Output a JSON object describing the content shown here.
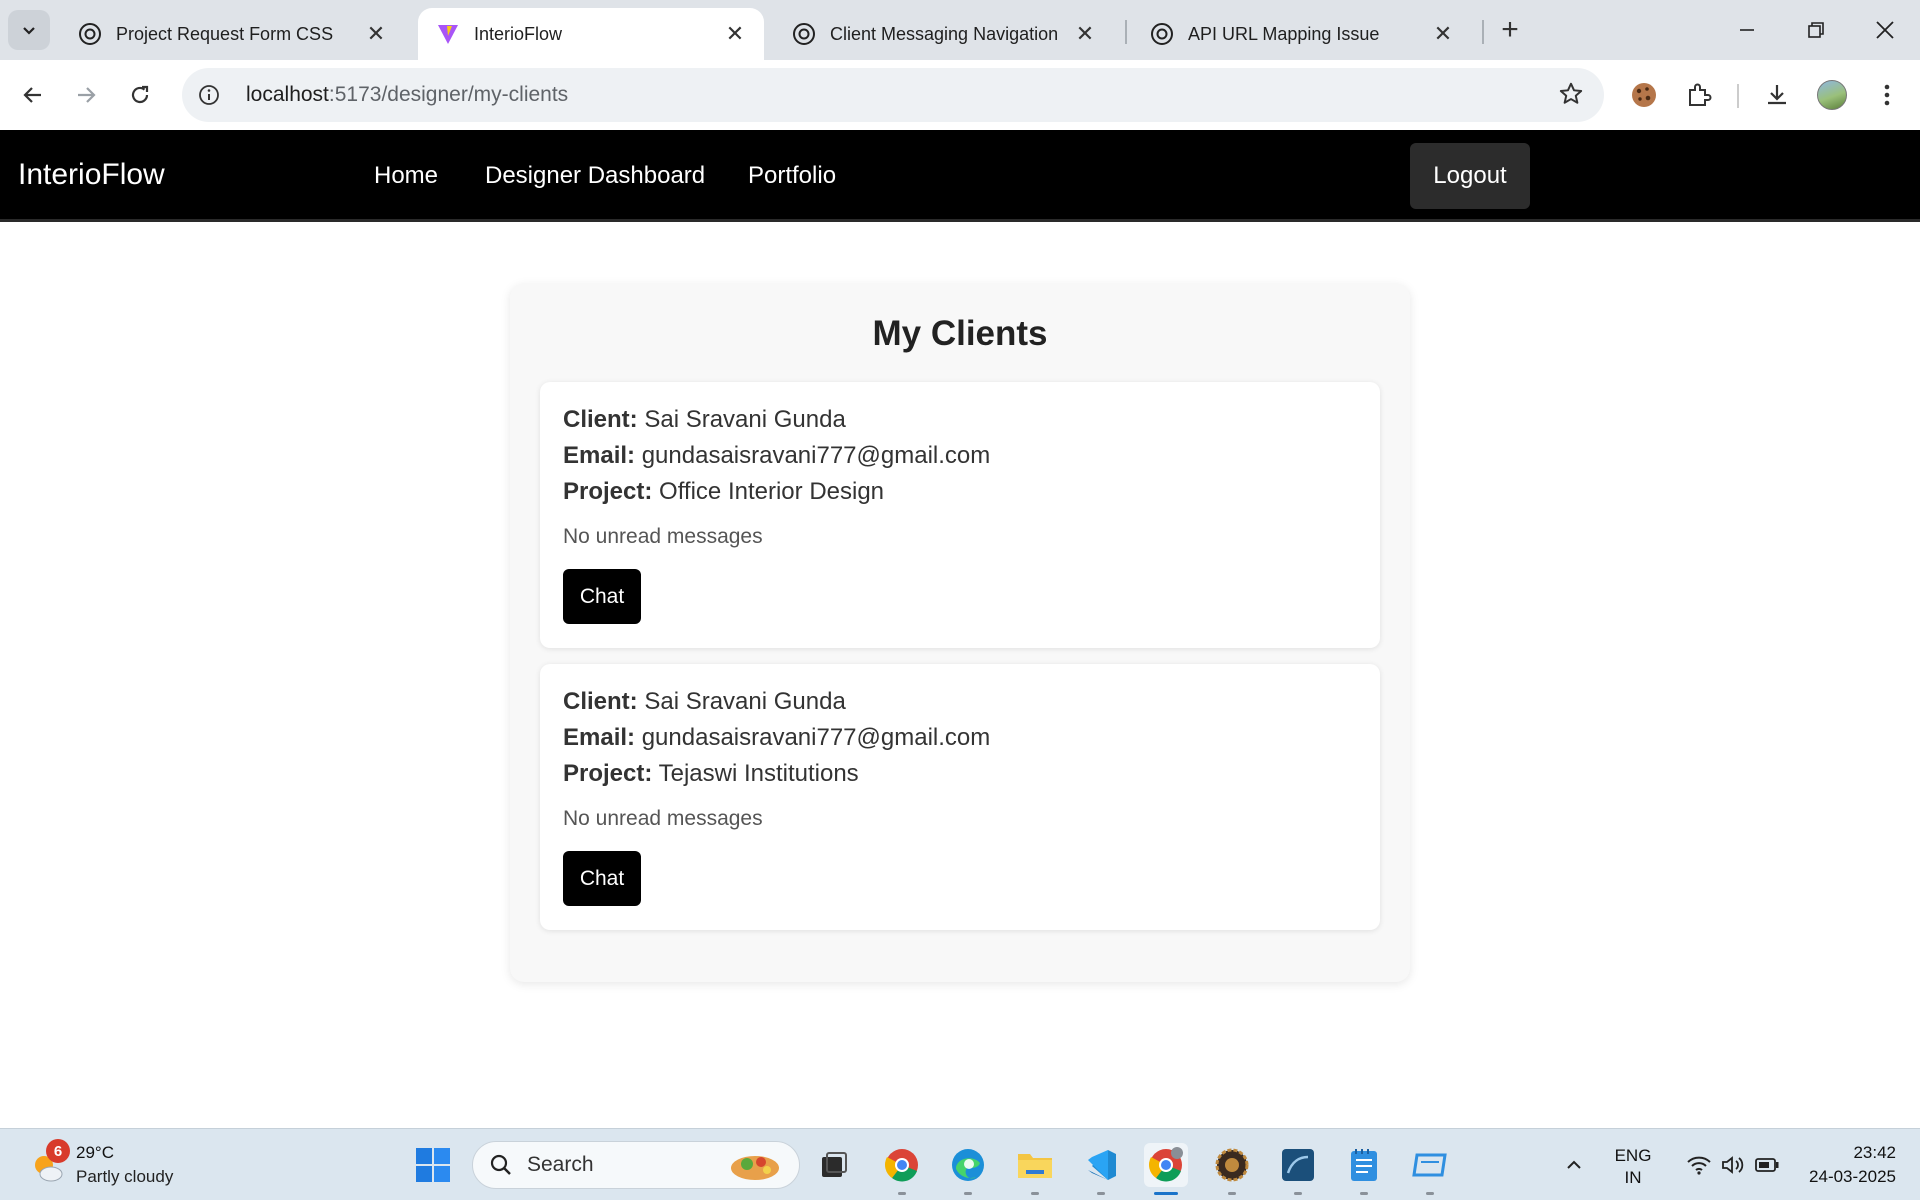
{
  "browser": {
    "tabs": [
      {
        "title": "Project Request Form CSS",
        "icon": "openai-icon",
        "active": false
      },
      {
        "title": "InterioFlow",
        "icon": "vite-icon",
        "active": true
      },
      {
        "title": "Client Messaging Navigation",
        "icon": "openai-icon",
        "active": false
      },
      {
        "title": "API URL Mapping Issue",
        "icon": "openai-icon",
        "active": false
      }
    ],
    "url_host": "localhost",
    "url_path": ":5173/designer/my-clients"
  },
  "app": {
    "brand": "InterioFlow",
    "nav": {
      "home": "Home",
      "dashboard": "Designer Dashboard",
      "portfolio": "Portfolio",
      "logout": "Logout"
    },
    "page_title": "My Clients",
    "field_labels": {
      "client": "Client:",
      "email": "Email:",
      "project": "Project:"
    },
    "clients": [
      {
        "client": "Sai Sravani Gunda",
        "email": "gundasaisravani777@gmail.com",
        "project": "Office Interior Design",
        "status": "No unread messages",
        "chat_label": "Chat"
      },
      {
        "client": "Sai Sravani Gunda",
        "email": "gundasaisravani777@gmail.com",
        "project": "Tejaswi Institutions",
        "status": "No unread messages",
        "chat_label": "Chat"
      }
    ]
  },
  "taskbar": {
    "weather_badge": "6",
    "temperature": "29°C",
    "condition": "Partly cloudy",
    "search_label": "Search",
    "language_top": "ENG",
    "language_bottom": "IN",
    "time": "23:42",
    "date": "24-03-2025"
  },
  "colors": {
    "navbar_bg": "#000000",
    "logout_bg": "#2c2c2c",
    "chat_button_bg": "#000000",
    "panel_bg": "#f8f8f8",
    "card_bg": "#ffffff"
  }
}
